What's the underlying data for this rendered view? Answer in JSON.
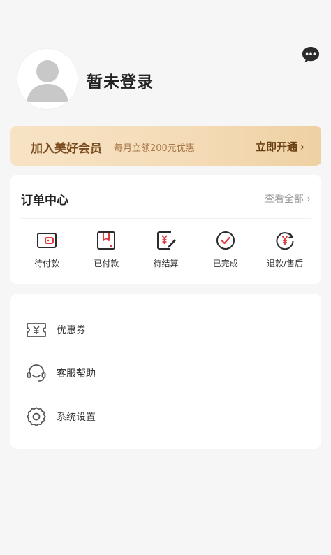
{
  "profile": {
    "name": "暂未登录"
  },
  "membership": {
    "title": "加入美好会员",
    "subtitle": "每月立领200元优惠",
    "cta": "立即开通",
    "cta_chevron": "›",
    "colors": {
      "accent": "#7a4b1e",
      "bg_start": "#f7e3c5",
      "bg_end": "#eed1a3"
    }
  },
  "orders": {
    "title": "订单中心",
    "view_all": "查看全部",
    "view_all_chevron": "›",
    "items": [
      {
        "label": "待付款",
        "icon": "wallet-icon"
      },
      {
        "label": "已付款",
        "icon": "bookmark-box-icon"
      },
      {
        "label": "待结算",
        "icon": "yen-edit-icon"
      },
      {
        "label": "已完成",
        "icon": "check-circle-icon"
      },
      {
        "label": "退款/售后",
        "icon": "yen-refresh-icon"
      }
    ],
    "icon_color": "#e03a3a"
  },
  "tools": {
    "items": [
      {
        "label": "优惠券",
        "icon": "coupon-icon"
      },
      {
        "label": "客服帮助",
        "icon": "headset-icon"
      },
      {
        "label": "系统设置",
        "icon": "gear-icon"
      }
    ]
  }
}
